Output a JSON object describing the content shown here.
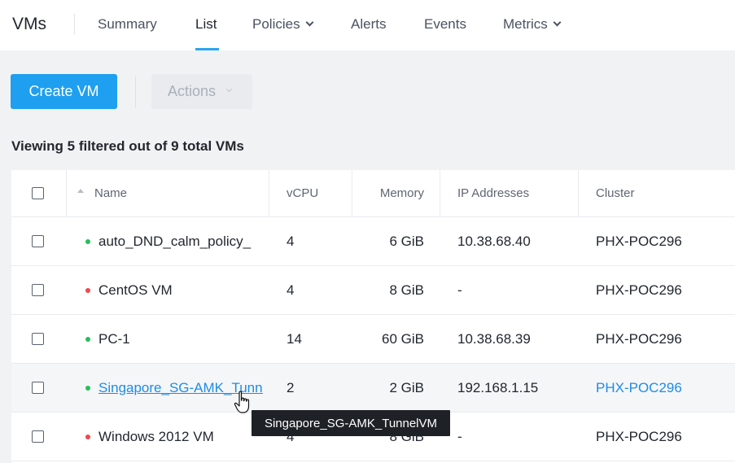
{
  "app_title": "VMs",
  "nav": {
    "summary": "Summary",
    "list": "List",
    "policies": "Policies",
    "alerts": "Alerts",
    "events": "Events",
    "metrics": "Metrics"
  },
  "toolbar": {
    "create_label": "Create VM",
    "actions_label": "Actions"
  },
  "viewing_text": "Viewing 5 filtered out of 9 total VMs",
  "table": {
    "headers": {
      "name": "Name",
      "vcpu": "vCPU",
      "memory": "Memory",
      "ip": "IP Addresses",
      "cluster": "Cluster"
    },
    "rows": [
      {
        "name": "auto_DND_calm_policy_",
        "status": "on",
        "vcpu": "4",
        "memory": "6 GiB",
        "ip": "10.38.68.40",
        "cluster": "PHX-POC296"
      },
      {
        "name": "CentOS VM",
        "status": "off",
        "vcpu": "4",
        "memory": "8 GiB",
        "ip": "-",
        "cluster": "PHX-POC296"
      },
      {
        "name": "PC-1",
        "status": "on",
        "vcpu": "14",
        "memory": "60 GiB",
        "ip": "10.38.68.39",
        "cluster": "PHX-POC296"
      },
      {
        "name": "Singapore_SG-AMK_TunnelVM",
        "status": "on",
        "vcpu": "2",
        "memory": "2 GiB",
        "ip": "192.168.1.15",
        "cluster": "PHX-POC296"
      },
      {
        "name": "Windows 2012 VM",
        "status": "off",
        "vcpu": "4",
        "memory": "8 GiB",
        "ip": "-",
        "cluster": "PHX-POC296"
      }
    ]
  },
  "tooltip": "Singapore_SG-AMK_TunnelVM",
  "colors": {
    "accent": "#1f9ff0",
    "status_on": "#24c05a",
    "status_off": "#f0474c",
    "link": "#1f8ce6"
  }
}
